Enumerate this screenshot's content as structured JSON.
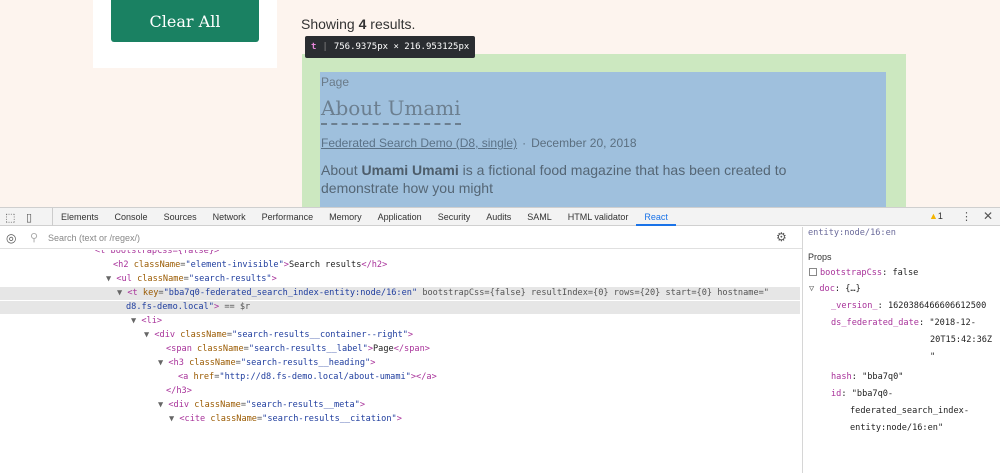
{
  "page": {
    "clear_all_label": "Clear All",
    "showing_prefix": "Showing ",
    "showing_count": "4",
    "showing_suffix": " results.",
    "tooltip": {
      "tag": "t",
      "sep": "|",
      "size": "756.9375px × 216.953125px"
    },
    "result": {
      "label": "Page",
      "title": "About Umami",
      "site_link": "Federated Search Demo (D8, single)",
      "date_sep": "·",
      "date": "December 20, 2018",
      "snippet_before": "About ",
      "snippet_bold": "Umami Umami",
      "snippet_after": " is a fictional food magazine that has been created to demonstrate how you might"
    }
  },
  "devtools": {
    "tabs": [
      "Elements",
      "Console",
      "Sources",
      "Network",
      "Performance",
      "Memory",
      "Application",
      "Security",
      "Audits",
      "SAML",
      "HTML validator",
      "React"
    ],
    "active_tab": "React",
    "warning_count": "1",
    "search_placeholder": "Search (text or /regex/)",
    "props_header": "Props",
    "props_top_cut": "entity:node/16:en"
  },
  "tree_lines": [
    {
      "text": "<t bootstrapCss={false}>"
    },
    {
      "tag_open": "<h2 ",
      "attr": "className",
      "eq": "=",
      "val": "\"element-invisible\"",
      "tag_close": ">",
      "txt": "Search results",
      "end": "</h2>"
    },
    {
      "tri": "▼ ",
      "tag_open": "<ul ",
      "attr": "className",
      "eq": "=",
      "val": "\"search-results\"",
      "tag_close": ">"
    },
    {
      "tri": "▼ ",
      "tag_open": "<t ",
      "attr": "key",
      "eq": "=",
      "val": "\"bba7q0-federated_search_index-entity:node/16:en\"",
      "rest": " bootstrapCss={false} resultIndex={0} rows={20} start={0} hostname=\""
    },
    {
      "cont": "d8.fs-demo.local\"",
      "tag_close": ">",
      "eqsr": " == $r"
    },
    {
      "tri": "▼ ",
      "tag_open": "<li",
      "tag_close": ">"
    },
    {
      "tri": "▼ ",
      "tag_open": "<div ",
      "attr": "className",
      "eq": "=",
      "val": "\"search-results__container--right\"",
      "tag_close": ">"
    },
    {
      "tag_open": "<span ",
      "attr": "className",
      "eq": "=",
      "val": "\"search-results__label\"",
      "tag_close": ">",
      "txt": "Page",
      "end": "</span>"
    },
    {
      "tri": "▼ ",
      "tag_open": "<h3 ",
      "attr": "className",
      "eq": "=",
      "val": "\"search-results__heading\"",
      "tag_close": ">"
    },
    {
      "tag_open": "<a ",
      "attr": "href",
      "eq": "=",
      "val": "\"http://d8.fs-demo.local/about-umami\"",
      "tag_close": ">",
      "end": "</a>"
    },
    {
      "tag_open": "</h3>"
    },
    {
      "tri": "▼ ",
      "tag_open": "<div ",
      "attr": "className",
      "eq": "=",
      "val": "\"search-results__meta\"",
      "tag_close": ">"
    },
    {
      "tri": "▼ ",
      "tag_open": "<cite ",
      "attr": "className",
      "eq": "=",
      "val": "\"search-results__citation\"",
      "tag_close": ">"
    }
  ],
  "props": {
    "bootstrap_key": "bootstrapCss",
    "bootstrap_val": "false",
    "doc_key": "doc",
    "doc_val": "{…}",
    "version_key": "_version_",
    "version_val": "1620386466606612500",
    "date_key": "ds_federated_date",
    "date_val_1": "\"2018-12-",
    "date_val_2": "20T15:42:36Z",
    "date_val_3": "\"",
    "hash_key": "hash",
    "hash_val": "\"bba7q0\"",
    "id_key": "id",
    "id_val_1": "\"bba7q0-",
    "id_val_2": "federated_search_index-",
    "id_val_3": "entity:node/16:en\""
  }
}
